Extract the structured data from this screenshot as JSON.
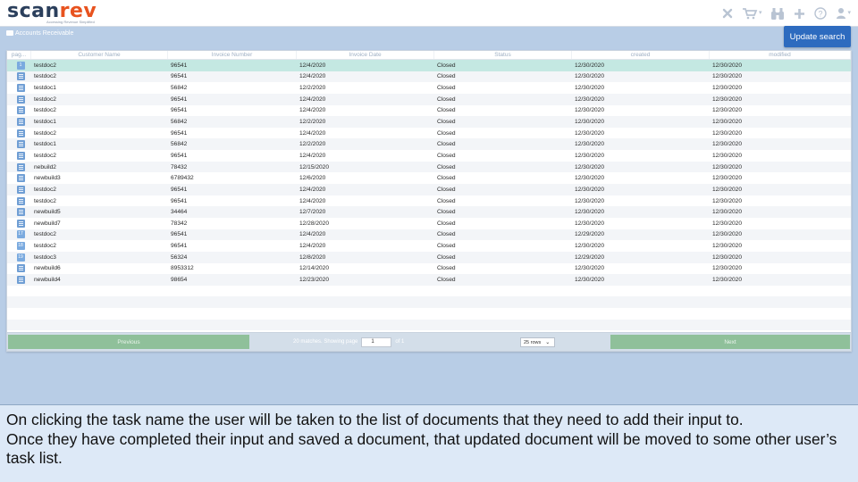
{
  "app": {
    "logo_scan": "scan",
    "logo_rev": "rev",
    "logo_tagline": "Accessing Revenue Simplified",
    "header_icons": [
      "close-icon",
      "cart-icon",
      "binoculars-icon",
      "plus-icon",
      "help-icon",
      "user-icon"
    ]
  },
  "breadcrumb": {
    "label": "Accounts Receivable"
  },
  "toolbar": {
    "update_search_label": "Update search"
  },
  "grid": {
    "columns": [
      "pag...",
      "Customer Name",
      "Invoice Number",
      "Invoice Date",
      "Status",
      "created",
      "modified"
    ],
    "rows": [
      {
        "page": "1",
        "customer": "testdoc2",
        "invoice": "96541",
        "date": "12/4/2020",
        "status": "Closed",
        "created": "12/30/2020",
        "modified": "12/30/2020"
      },
      {
        "page": "",
        "customer": "testdoc2",
        "invoice": "96541",
        "date": "12/4/2020",
        "status": "Closed",
        "created": "12/30/2020",
        "modified": "12/30/2020"
      },
      {
        "page": "",
        "customer": "testdoc1",
        "invoice": "56842",
        "date": "12/2/2020",
        "status": "Closed",
        "created": "12/30/2020",
        "modified": "12/30/2020"
      },
      {
        "page": "",
        "customer": "testdoc2",
        "invoice": "96541",
        "date": "12/4/2020",
        "status": "Closed",
        "created": "12/30/2020",
        "modified": "12/30/2020"
      },
      {
        "page": "",
        "customer": "testdoc2",
        "invoice": "96541",
        "date": "12/4/2020",
        "status": "Closed",
        "created": "12/30/2020",
        "modified": "12/30/2020"
      },
      {
        "page": "",
        "customer": "testdoc1",
        "invoice": "56842",
        "date": "12/2/2020",
        "status": "Closed",
        "created": "12/30/2020",
        "modified": "12/30/2020"
      },
      {
        "page": "",
        "customer": "testdoc2",
        "invoice": "96541",
        "date": "12/4/2020",
        "status": "Closed",
        "created": "12/30/2020",
        "modified": "12/30/2020"
      },
      {
        "page": "",
        "customer": "testdoc1",
        "invoice": "56842",
        "date": "12/2/2020",
        "status": "Closed",
        "created": "12/30/2020",
        "modified": "12/30/2020"
      },
      {
        "page": "",
        "customer": "testdoc2",
        "invoice": "96541",
        "date": "12/4/2020",
        "status": "Closed",
        "created": "12/30/2020",
        "modified": "12/30/2020"
      },
      {
        "page": "",
        "customer": "nebuild2",
        "invoice": "78432",
        "date": "12/15/2020",
        "status": "Closed",
        "created": "12/30/2020",
        "modified": "12/30/2020"
      },
      {
        "page": "",
        "customer": "newbuild3",
        "invoice": "6789432",
        "date": "12/6/2020",
        "status": "Closed",
        "created": "12/30/2020",
        "modified": "12/30/2020"
      },
      {
        "page": "",
        "customer": "testdoc2",
        "invoice": "96541",
        "date": "12/4/2020",
        "status": "Closed",
        "created": "12/30/2020",
        "modified": "12/30/2020"
      },
      {
        "page": "",
        "customer": "testdoc2",
        "invoice": "96541",
        "date": "12/4/2020",
        "status": "Closed",
        "created": "12/30/2020",
        "modified": "12/30/2020"
      },
      {
        "page": "",
        "customer": "newbuild5",
        "invoice": "34464",
        "date": "12/7/2020",
        "status": "Closed",
        "created": "12/30/2020",
        "modified": "12/30/2020"
      },
      {
        "page": "",
        "customer": "newbuild7",
        "invoice": "78342",
        "date": "12/28/2020",
        "status": "Closed",
        "created": "12/30/2020",
        "modified": "12/30/2020"
      },
      {
        "page": "17",
        "customer": "testdoc2",
        "invoice": "96541",
        "date": "12/4/2020",
        "status": "Closed",
        "created": "12/29/2020",
        "modified": "12/30/2020"
      },
      {
        "page": "18",
        "customer": "testdoc2",
        "invoice": "96541",
        "date": "12/4/2020",
        "status": "Closed",
        "created": "12/30/2020",
        "modified": "12/30/2020"
      },
      {
        "page": "19",
        "customer": "testdoc3",
        "invoice": "56324",
        "date": "12/8/2020",
        "status": "Closed",
        "created": "12/29/2020",
        "modified": "12/30/2020"
      },
      {
        "page": "",
        "customer": "newbuild6",
        "invoice": "8953312",
        "date": "12/14/2020",
        "status": "Closed",
        "created": "12/30/2020",
        "modified": "12/30/2020"
      },
      {
        "page": "",
        "customer": "newbuild4",
        "invoice": "98654",
        "date": "12/23/2020",
        "status": "Closed",
        "created": "12/30/2020",
        "modified": "12/30/2020"
      }
    ],
    "empty_rows": 4
  },
  "pager": {
    "previous_label": "Previous",
    "next_label": "Next",
    "matches_text": "20 matches. Showing page",
    "page_value": "1",
    "of_text": "of 1",
    "rows_option": "25 rows"
  },
  "caption": {
    "line1": "On clicking the task name the user will be taken to the list of documents that they need to add their input to.",
    "line2": "Once they have completed their input and saved a document, that updated document will be moved to some other user’s task list."
  },
  "colors": {
    "background": "#b8cde6",
    "accent": "#2d6bbf",
    "brand_orange": "#e8531f",
    "brand_navy": "#2b3f5c",
    "pager_button": "#8fc09a",
    "selected_row": "#c4e8e2"
  }
}
